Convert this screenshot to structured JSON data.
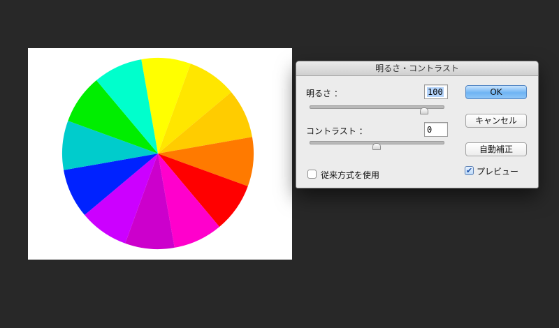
{
  "wheel": {
    "colors": [
      "#ffff00",
      "#ffe600",
      "#ffcc00",
      "#ff7a00",
      "#ff0000",
      "#ff00cc",
      "#cc00cc",
      "#cc00ff",
      "#0022ff",
      "#00cccc",
      "#00ee00",
      "#00ffcc"
    ]
  },
  "dialog": {
    "title": "明るさ・コントラスト",
    "brightness": {
      "label": "明るさ ：",
      "value": "100",
      "level": 0.86
    },
    "contrast": {
      "label": "コントラスト ：",
      "value": "0",
      "level": 0.5
    },
    "legacy": {
      "label": "従来方式を使用",
      "checked": false
    },
    "buttons": {
      "ok": "OK",
      "cancel": "キャンセル",
      "auto": "自動補正"
    },
    "preview": {
      "label": "プレビュー",
      "checked": true,
      "check_glyph": "✔"
    }
  }
}
